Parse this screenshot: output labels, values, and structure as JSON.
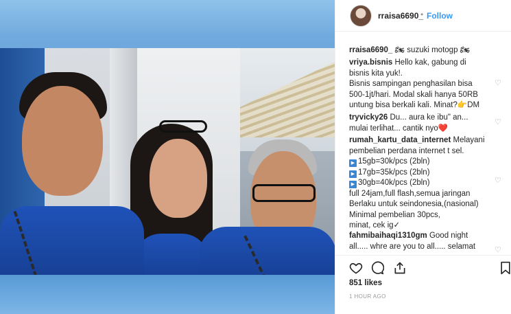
{
  "post": {
    "username": "rraisa6690_",
    "separator": "•",
    "follow_label": "Follow",
    "caption_text": "🏍 suzuki motogp 🏍",
    "likes": "851 likes",
    "timestamp": "1 HOUR AGO"
  },
  "comments": [
    {
      "user": "vriya.bisnis",
      "lines": [
        "Hello kak, gabung di",
        "bisnis kita yuk!.",
        "Bisnis sampingan penghasilan bisa",
        "500-1jt/hari. Modal skali hanya 50RB",
        "untung bisa berkali kali. Minat?👉DM"
      ]
    },
    {
      "user": "tryvicky26",
      "lines": [
        "Du... aura ke ibu\" an...",
        "mulai terlihat... cantik nyo❤️"
      ]
    },
    {
      "user": "rumah_kartu_data_internet",
      "lines": [
        "Melayani",
        "pembelian perdana internet t sel.",
        "15gb=30k/pcs (2bln)",
        "17gb=35k/pcs (2bln)",
        "30gb=40k/pcs (2bln)",
        "full 24jam,full flash,semua jaringan",
        "Berlaku untuk seindonesia,(nasional)",
        "Minimal pembelian 30pcs,",
        "minat, cek ig✓"
      ]
    },
    {
      "user": "fahmibaihaqi1310gm",
      "lines": [
        "Good night",
        "all..... whre are you to all..... selamat"
      ]
    }
  ],
  "icons": {
    "like": "heart-outline-icon",
    "comment": "speech-bubble-icon",
    "share": "share-upload-icon",
    "save": "bookmark-icon"
  },
  "colors": {
    "link": "#3897f0",
    "text": "#262626",
    "muted": "#999999",
    "media_bg": "#5a9bd6"
  }
}
